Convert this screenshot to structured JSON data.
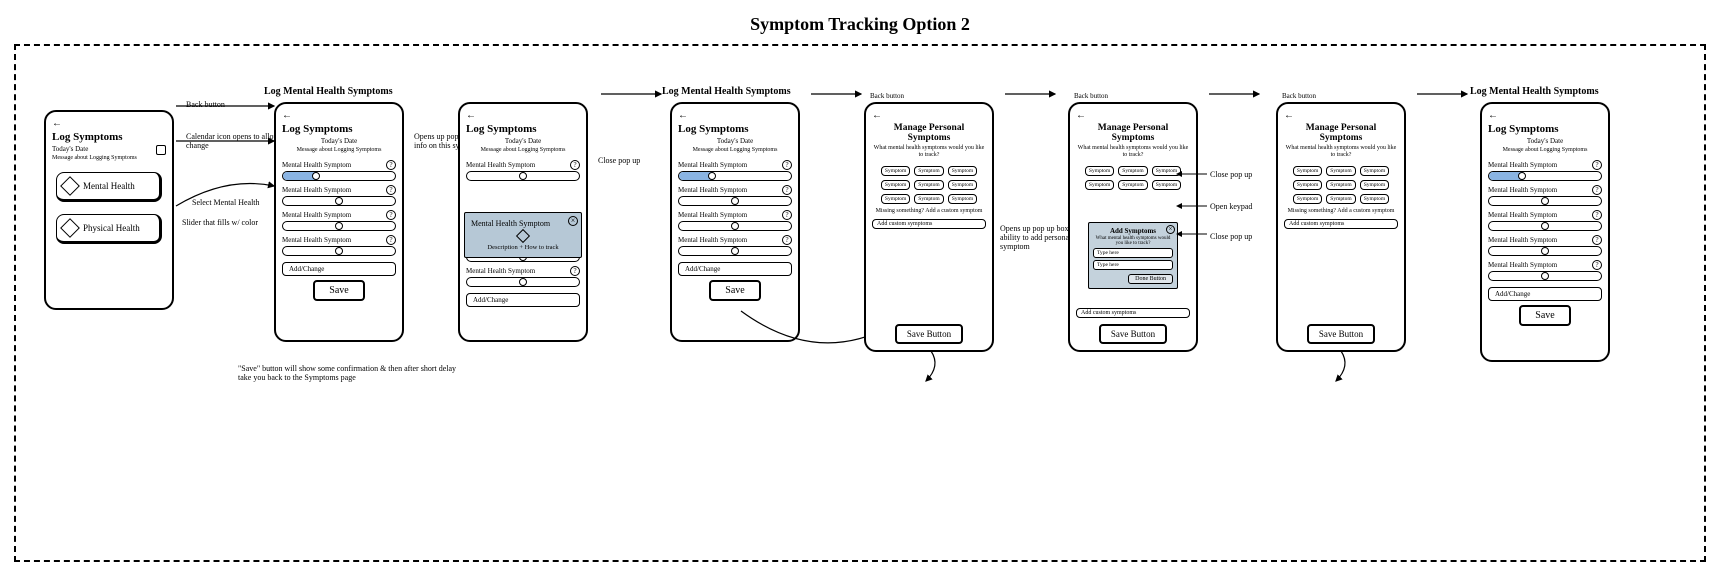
{
  "page_title": "Symptom Tracking Option 2",
  "common": {
    "log_symptoms": "Log Symptoms",
    "todays_date": "Today's Date",
    "msg": "Message about Logging Symptoms",
    "mental_health": "Mental Health",
    "physical_health": "Physical Health",
    "mh_symptom": "Mental Health Symptom",
    "add_change": "Add/Change",
    "save": "Save",
    "save_button": "Save Button",
    "done_button": "Done Button",
    "back_button": "Back button",
    "manage_personal": "Manage Personal Symptoms",
    "manage_q": "What mental health symptoms would you like to track?",
    "chip": "Symptom",
    "missing": "Missing something? Add a custom symptom",
    "add_custom": "Add custom symptoms",
    "add_symptoms": "Add Symptoms",
    "type_here": "Type here",
    "log_mh_title": "Log Mental Health Symptoms"
  },
  "popup": {
    "title": "Mental Health Symptom",
    "desc": "Description + How to track"
  },
  "annotations": {
    "cal": "Calendar icon opens to allow date change",
    "select_mh": "Select Mental Health",
    "slider_fills": "Slider that fills w/ color",
    "opens_info": "Opens up pop up box with more info on this symptom",
    "close_popup": "Close pop up",
    "save_note": "\"Save\" button will show some confirmation & then after short delay take you back to the Symptoms page",
    "opens_add": "Opens up pop up box with ability to add personal symptom",
    "open_keypad": "Open keypad"
  }
}
